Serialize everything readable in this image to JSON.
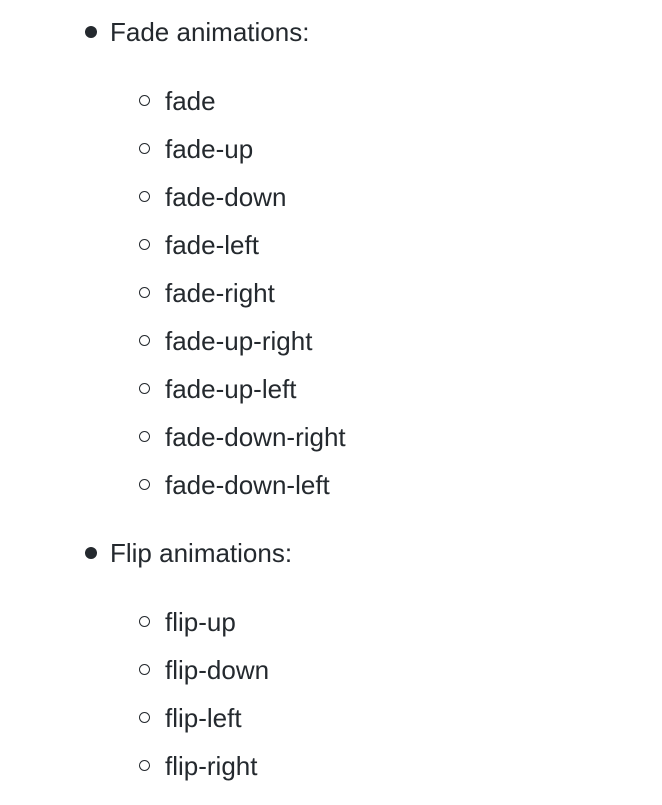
{
  "sections": [
    {
      "title": "Fade animations:",
      "items": [
        "fade",
        "fade-up",
        "fade-down",
        "fade-left",
        "fade-right",
        "fade-up-right",
        "fade-up-left",
        "fade-down-right",
        "fade-down-left"
      ]
    },
    {
      "title": "Flip animations:",
      "items": [
        "flip-up",
        "flip-down",
        "flip-left",
        "flip-right"
      ]
    }
  ]
}
